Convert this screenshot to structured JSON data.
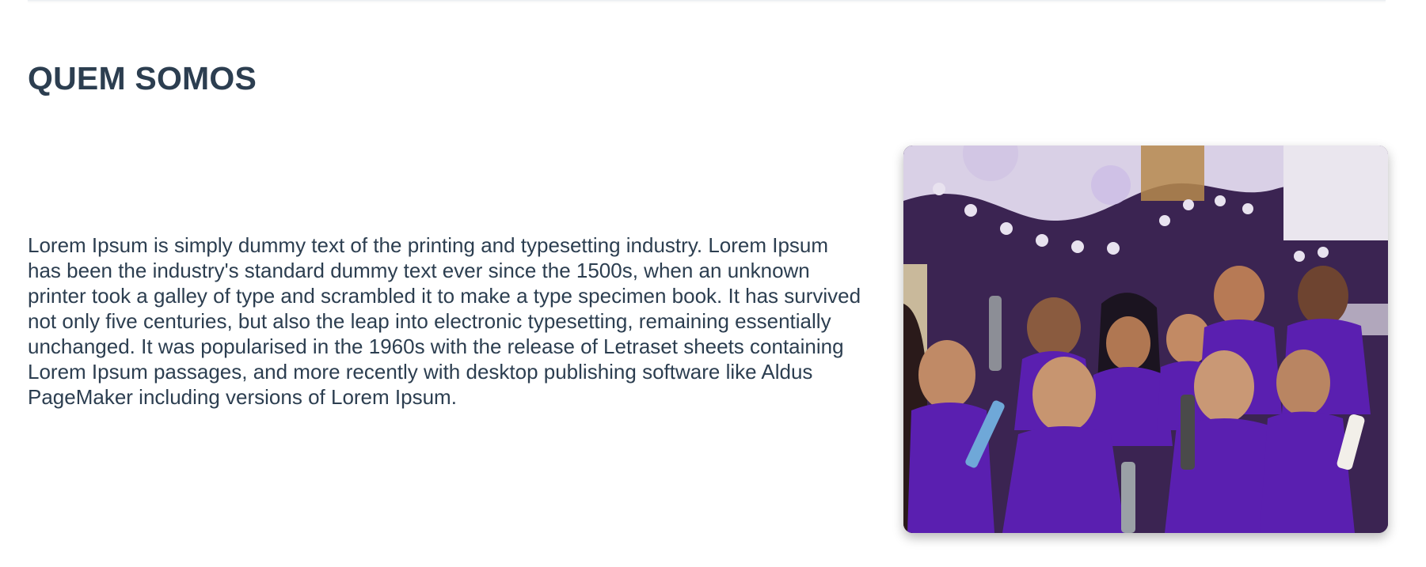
{
  "section": {
    "title": "QUEM SOMOS",
    "body": "Lorem Ipsum is simply dummy text of the printing and typesetting industry. Lorem Ipsum has been the industry's standard dummy text ever since the 1500s, when an unknown printer took a galley of type and scrambled it to make a type specimen book. It has survived not only five centuries, but also the leap into electronic typesetting, remaining essentially unchanged. It was popularised in the 1960s with the release of Letraset sheets containing Lorem Ipsum passages, and more recently with desktop publishing software like Aldus PageMaker including versions of Lorem Ipsum."
  },
  "photo": {
    "subject": "team-photo-people-in-purple-uniforms-holding-bottles",
    "colors": {
      "uniform": "#5a1fb0",
      "wall": "#3b2452",
      "wall_top": "#d9d0e6"
    }
  }
}
